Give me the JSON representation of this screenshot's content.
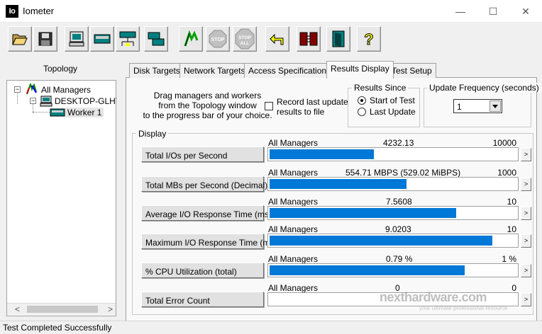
{
  "window": {
    "title": "Iometer",
    "app_icon_text": "Io",
    "minimize": "—",
    "maximize": "☐",
    "close": "✕"
  },
  "toolbar": {
    "buttons": [
      {
        "name": "open-config",
        "icon": "folder-open-icon"
      },
      {
        "name": "save-config",
        "icon": "floppy-save-icon"
      },
      {
        "name": "start-display-manager",
        "icon": "computer-manager-icon"
      },
      {
        "name": "start-disk-worker",
        "icon": "disk-worker-icon"
      },
      {
        "name": "start-network-worker",
        "icon": "network-worker-icon"
      },
      {
        "name": "copy-worker",
        "icon": "duplicate-worker-icon"
      },
      {
        "name": "start-test",
        "icon": "green-flag-icon"
      },
      {
        "name": "stop-test",
        "icon": "stop-sign-icon",
        "label": "STOP"
      },
      {
        "name": "stop-all",
        "icon": "stop-all-sign-icon",
        "label": "STOP ALL"
      },
      {
        "name": "reset-workers",
        "icon": "reset-arrow-icon"
      },
      {
        "name": "disconnect-managers",
        "icon": "disconnect-icon"
      },
      {
        "name": "exit",
        "icon": "exit-door-icon"
      },
      {
        "name": "about",
        "icon": "help-question-icon",
        "label": "?"
      }
    ]
  },
  "topology": {
    "title": "Topology",
    "root": "All Managers",
    "manager": "DESKTOP-GLHTM",
    "worker": "Worker 1",
    "scroll_left": "<",
    "scroll_right": ">"
  },
  "tabs": [
    {
      "label": "Disk Targets",
      "active": false
    },
    {
      "label": "Network Targets",
      "active": false
    },
    {
      "label": "Access Specifications",
      "active": false
    },
    {
      "label": "Results Display",
      "active": true
    },
    {
      "label": "Test Setup",
      "active": false
    }
  ],
  "results": {
    "drag_hint_lines": [
      "Drag managers and workers",
      "from the Topology window",
      "to the progress bar of your choice."
    ],
    "record_checkbox": {
      "label_lines": [
        "Record last update",
        "results to file"
      ],
      "checked": false
    },
    "results_since": {
      "legend": "Results Since",
      "options": [
        {
          "label": "Start of Test",
          "selected": true
        },
        {
          "label": "Last Update",
          "selected": false
        }
      ]
    },
    "update_frequency": {
      "legend": "Update Frequency (seconds)",
      "value": "1"
    },
    "display_legend": "Display",
    "arrow_glyph": ">",
    "metrics": [
      {
        "button": "Total I/Os per Second",
        "source": "All Managers",
        "value": "4232.13",
        "max": "10000",
        "fraction": 0.4232
      },
      {
        "button": "Total MBs per Second (Decimal)",
        "source": "All Managers",
        "value": "554.71 MBPS (529.02 MiBPS)",
        "max": "1000",
        "fraction": 0.5547
      },
      {
        "button": "Average I/O Response Time (ms)",
        "source": "All Managers",
        "value": "7.5608",
        "max": "10",
        "fraction": 0.7561
      },
      {
        "button": "Maximum I/O Response Time (ms)",
        "source": "All Managers",
        "value": "9.0203",
        "max": "10",
        "fraction": 0.902
      },
      {
        "button": "% CPU Utilization (total)",
        "source": "All Managers",
        "value": "0.79 %",
        "max": "1 %",
        "fraction": 0.79
      },
      {
        "button": "Total Error Count",
        "source": "All Managers",
        "value": "0",
        "max": "0",
        "fraction": 0
      }
    ]
  },
  "watermark": {
    "brand": "nexthardware.com",
    "tagline": "your ultimate professional resource"
  },
  "status": {
    "text": "Test Completed Successfully"
  }
}
